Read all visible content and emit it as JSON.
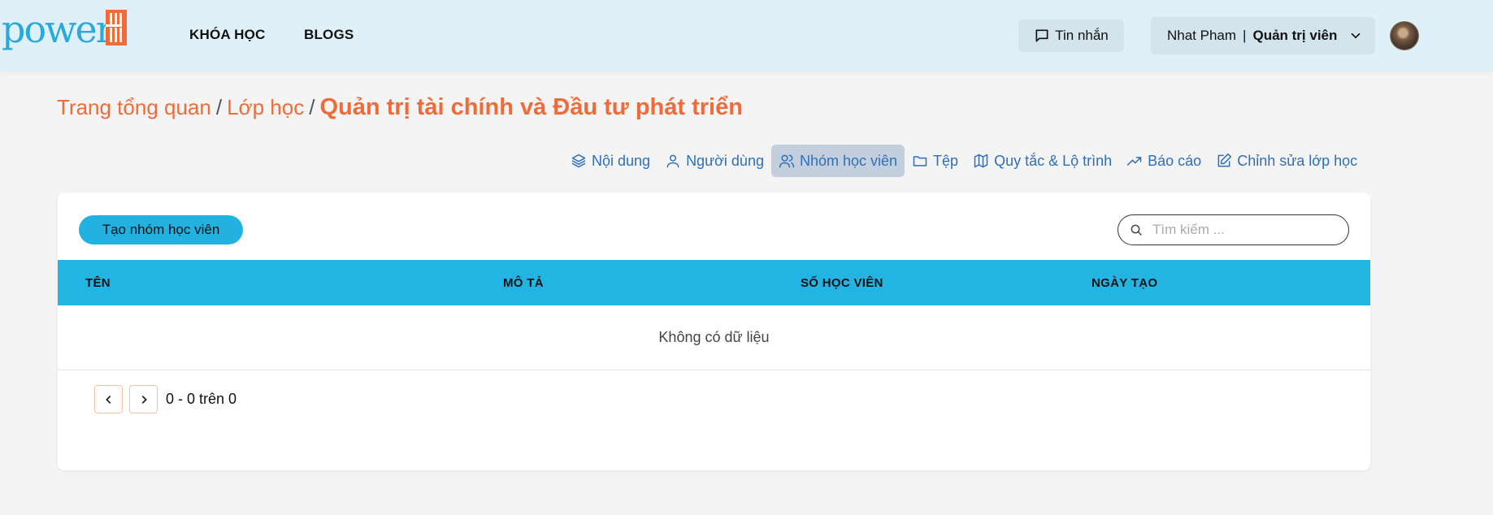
{
  "header": {
    "logo_text": "power",
    "nav": [
      "KHÓA HỌC",
      "BLOGS"
    ],
    "messages_label": "Tin nhắn",
    "user_name": "Nhat Pham",
    "user_separator": "|",
    "user_role": "Quản trị viên"
  },
  "breadcrumb": {
    "items": [
      "Trang tổng quan",
      "Lớp học"
    ],
    "separator": "/",
    "current": "Quản trị tài chính và Đầu tư phát triển"
  },
  "tabs": [
    {
      "label": "Nội dung",
      "icon": "layers-icon",
      "active": false
    },
    {
      "label": "Người dùng",
      "icon": "user-icon",
      "active": false
    },
    {
      "label": "Nhóm học viên",
      "icon": "users-icon",
      "active": true
    },
    {
      "label": "Tệp",
      "icon": "folder-icon",
      "active": false
    },
    {
      "label": "Quy tắc & Lộ trình",
      "icon": "map-icon",
      "active": false
    },
    {
      "label": "Báo cáo",
      "icon": "trending-up-icon",
      "active": false
    },
    {
      "label": "Chỉnh sửa lớp học",
      "icon": "edit-icon",
      "active": false
    }
  ],
  "toolbar": {
    "create_label": "Tạo nhóm học viên",
    "search_placeholder": "Tìm kiếm ..."
  },
  "table": {
    "columns": [
      "TÊN",
      "MÔ TẢ",
      "SỐ HỌC VIÊN",
      "NGÀY TẠO"
    ],
    "empty_text": "Không có dữ liệu"
  },
  "pagination": {
    "summary": "0 - 0 trên 0"
  },
  "colors": {
    "accent_orange": "#ef6c3a",
    "accent_blue": "#22b4e3",
    "tab_blue": "#2f6fb8"
  }
}
